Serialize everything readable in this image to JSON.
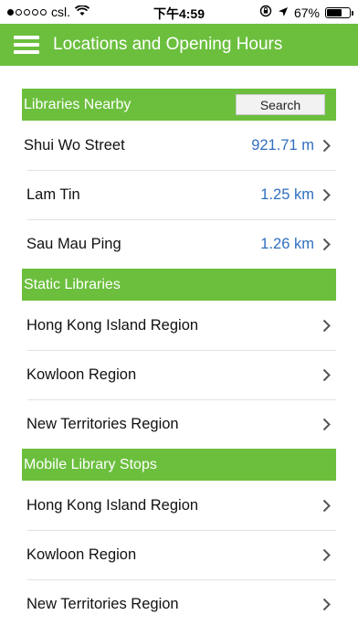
{
  "status_bar": {
    "carrier": "csl.",
    "time": "下午4:59",
    "battery": "67%",
    "battery_level": 0.67
  },
  "header": {
    "title": "Locations and Opening Hours",
    "menu_icon": "hamburger-menu-icon"
  },
  "nearby": {
    "title": "Libraries Nearby",
    "search_label": "Search",
    "items": [
      {
        "name": "Shui Wo Street",
        "distance": "921.71 m"
      },
      {
        "name": "Lam Tin",
        "distance": "1.25 km"
      },
      {
        "name": "Sau Mau Ping",
        "distance": "1.26 km"
      }
    ]
  },
  "static_libraries": {
    "title": "Static Libraries",
    "items": [
      {
        "name": "Hong Kong Island Region"
      },
      {
        "name": "Kowloon Region"
      },
      {
        "name": "New Territories Region"
      }
    ]
  },
  "mobile_stops": {
    "title": "Mobile Library Stops",
    "items": [
      {
        "name": "Hong Kong Island Region"
      },
      {
        "name": "Kowloon Region"
      },
      {
        "name": "New Territories Region"
      }
    ]
  },
  "colors": {
    "accent_green": "#6bbf3d",
    "distance_blue": "#2f6fbf"
  }
}
